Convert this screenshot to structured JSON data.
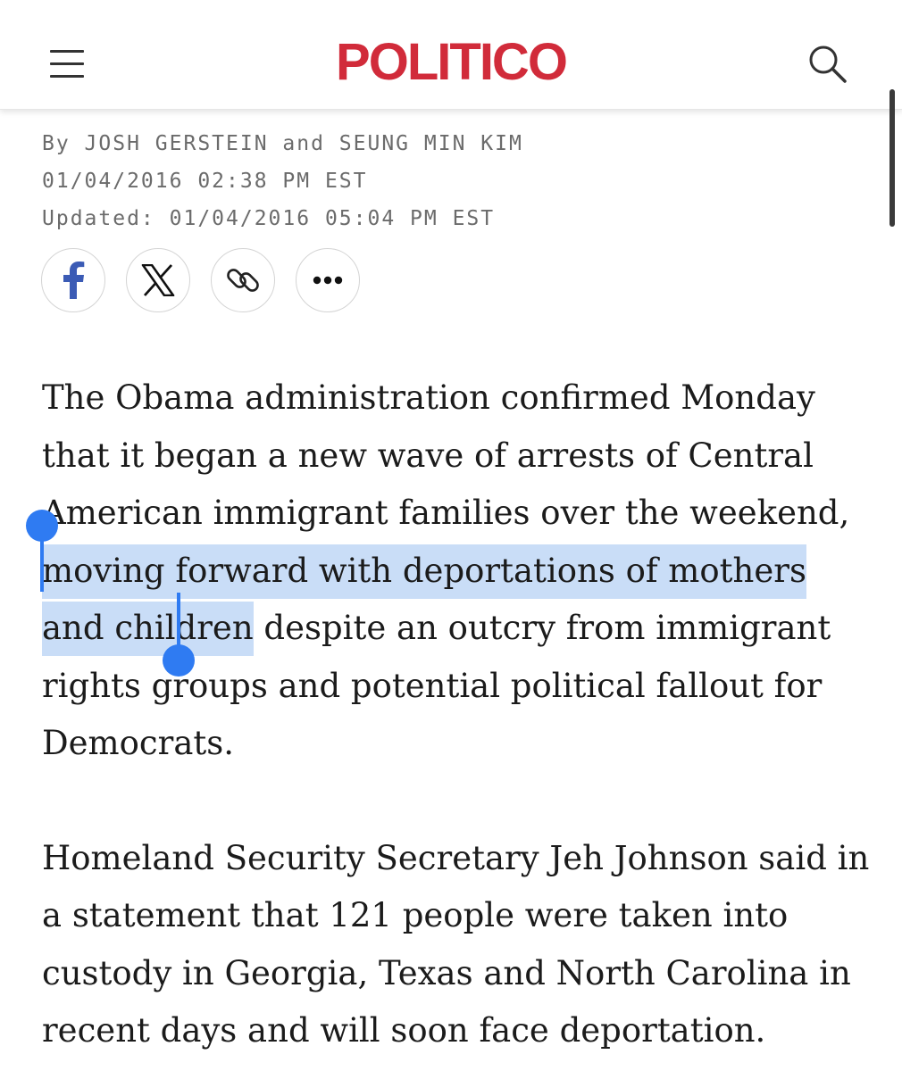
{
  "header": {
    "logo_text": "POLITICO",
    "menu_icon": "hamburger-menu-icon",
    "search_icon": "search-icon",
    "logo_color": "#d12b3a"
  },
  "byline": {
    "authors": "By JOSH GERSTEIN and SEUNG MIN KIM",
    "published": "01/04/2016 02:38 PM EST",
    "updated": "Updated: 01/04/2016 05:04 PM EST"
  },
  "share": {
    "buttons": [
      {
        "name": "facebook",
        "icon": "facebook-icon"
      },
      {
        "name": "x",
        "icon": "x-icon"
      },
      {
        "name": "copy-link",
        "icon": "link-icon"
      },
      {
        "name": "more",
        "icon": "more-icon"
      }
    ]
  },
  "article": {
    "p1_before": "The Obama administration confirmed Monday that it began a new wave of arrests of Central American immigrant families over the weekend, ",
    "p1_selected": "moving forward with deportations of mothers and children",
    "p1_after": " despite an outcry from immigrant rights groups and potential political fallout for Democrats.",
    "p2": "Homeland Security Secretary Jeh Johnson said in a statement that 121 people were taken into custody in Georgia, Texas and North Carolina in recent days and will soon face deportation."
  },
  "colors": {
    "selection_highlight": "#c9ddf7",
    "selection_handle": "#2f7bf2",
    "byline_text": "#6b6b6b"
  }
}
